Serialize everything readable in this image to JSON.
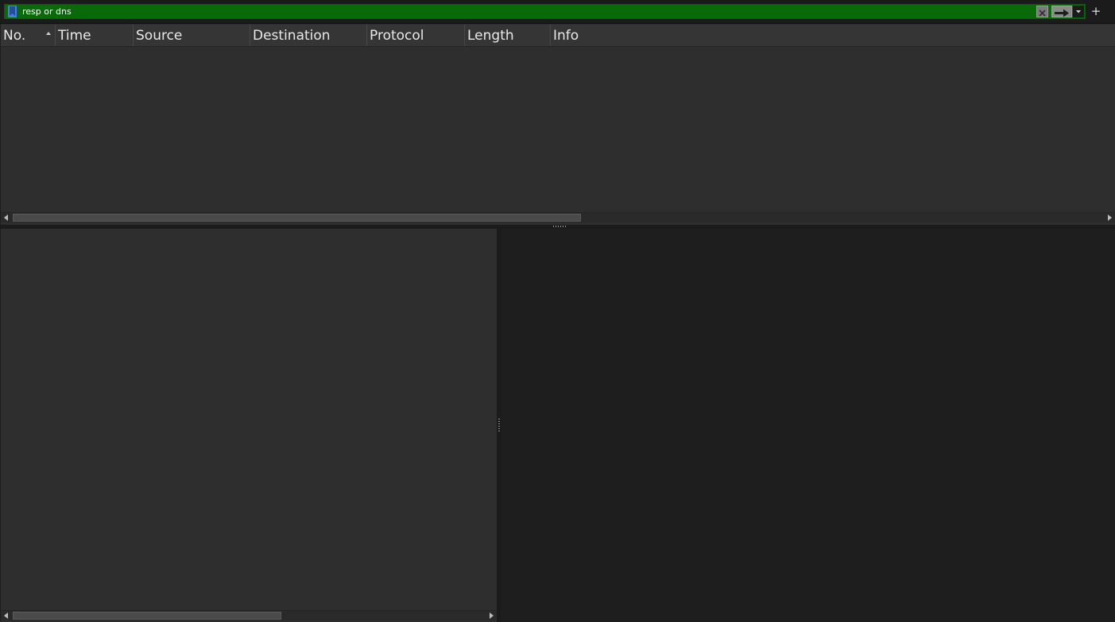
{
  "filter": {
    "value": "resp or dns",
    "placeholder": "",
    "field_color": "#0a6a0a",
    "bookmark_icon": "bookmark-icon",
    "clear_icon": "clear-x-icon",
    "apply_icon": "apply-arrow-icon",
    "dropdown_icon": "chevron-down-icon",
    "add_label": "+"
  },
  "packet_list": {
    "columns": [
      {
        "label": "No.",
        "sorted": "ascending"
      },
      {
        "label": "Time"
      },
      {
        "label": "Source"
      },
      {
        "label": "Destination"
      },
      {
        "label": "Protocol"
      },
      {
        "label": "Length"
      },
      {
        "label": "Info"
      }
    ],
    "rows": []
  },
  "colors": {
    "background": "#1e1e1e",
    "panel": "#2e2e2e",
    "header": "#353535",
    "text": "#e9e9e9"
  }
}
